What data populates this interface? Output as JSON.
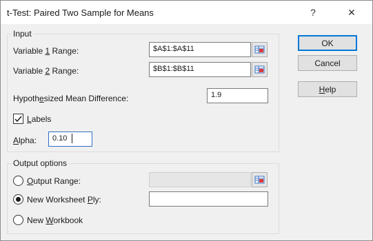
{
  "window": {
    "title": "t-Test: Paired Two Sample for Means",
    "help_glyph": "?",
    "close_glyph": "✕"
  },
  "input_group": {
    "label": "Input",
    "variable1": {
      "label_pre": "Variable ",
      "label_key": "1",
      "label_post": " Range:",
      "value": "$A$1:$A$11"
    },
    "variable2": {
      "label_pre": "Variable ",
      "label_key": "2",
      "label_post": " Range:",
      "value": "$B$1:$B$11"
    },
    "hypothesized": {
      "label_pre": "Hypoth",
      "label_key": "e",
      "label_post": "sized Mean Difference:",
      "value": "1.9"
    },
    "labels_checkbox": {
      "label_pre": "",
      "label_key": "L",
      "label_post": "abels",
      "checked": true
    },
    "alpha": {
      "label_pre": "",
      "label_key": "A",
      "label_post": "lpha:",
      "value": "0.10"
    }
  },
  "output_group": {
    "label": "Output options",
    "output_range": {
      "label_pre": "",
      "label_key": "O",
      "label_post": "utput Range:",
      "selected": false,
      "value": ""
    },
    "new_worksheet": {
      "label_pre": "New Worksheet ",
      "label_key": "P",
      "label_post": "ly:",
      "selected": true,
      "value": ""
    },
    "new_workbook": {
      "label_pre": "New ",
      "label_key": "W",
      "label_post": "orkbook",
      "selected": false
    }
  },
  "buttons": {
    "ok": "OK",
    "cancel": "Cancel",
    "help_pre": "",
    "help_key": "H",
    "help_post": "elp"
  },
  "colors": {
    "accent": "#0078d7",
    "ref_icon_red": "#d83b3b",
    "ref_icon_blue": "#3a73c4"
  },
  "icons": {
    "range_selector": "range-selector-icon",
    "checkmark": "checkmark-icon"
  }
}
